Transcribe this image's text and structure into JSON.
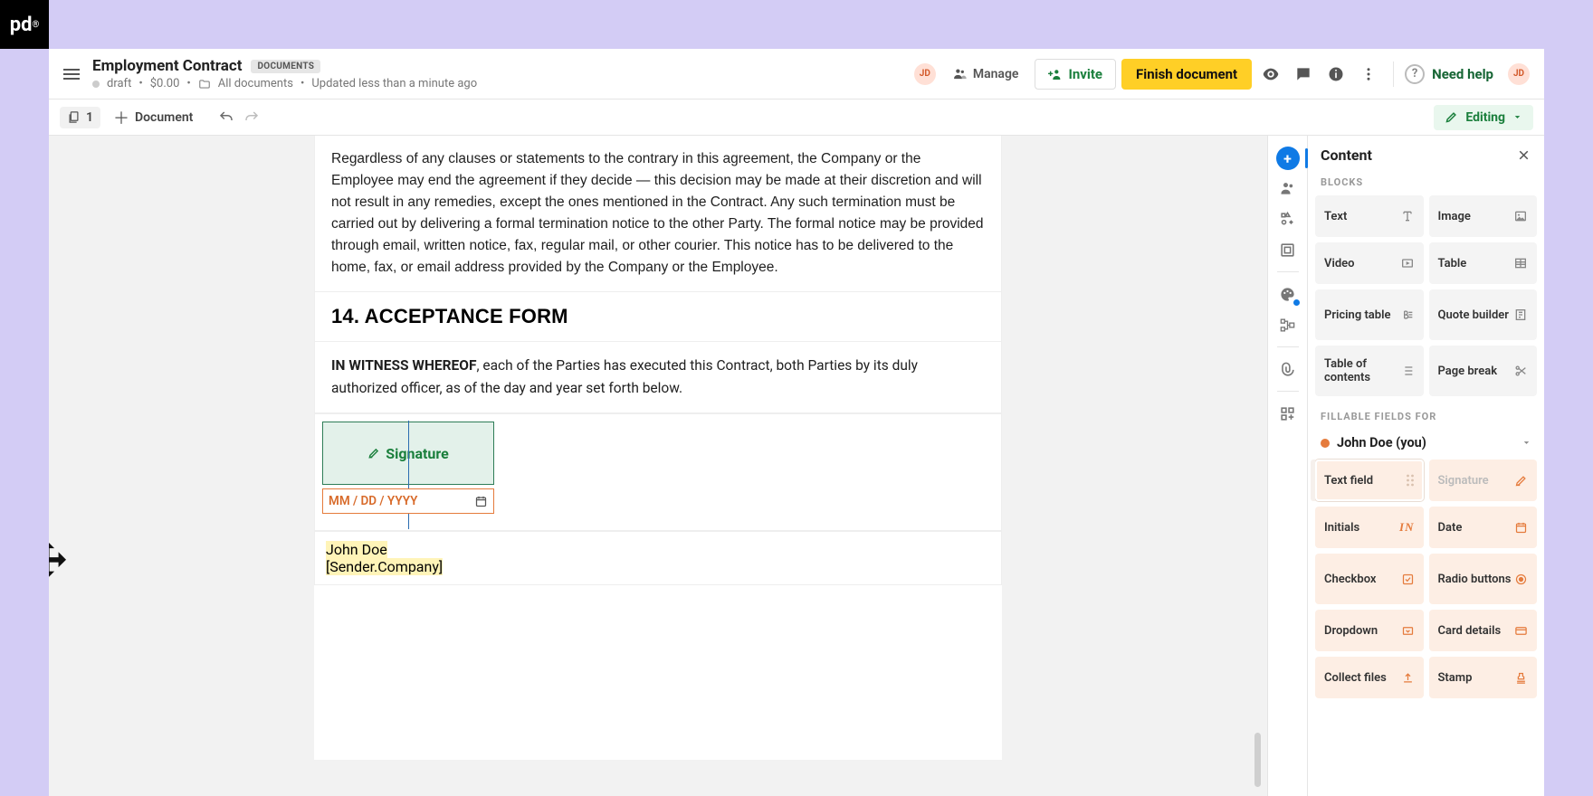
{
  "brand_logo_text": "pd",
  "header": {
    "title": "Employment Contract",
    "badge": "DOCUMENTS",
    "status": "draft",
    "amount": "$0.00",
    "crumb": "All documents",
    "updated": "Updated less than a minute ago",
    "manage": "Manage",
    "invite": "Invite",
    "finish": "Finish document",
    "need_help": "Need help",
    "user_initials": "JD"
  },
  "toolbar": {
    "page_count": "1",
    "add_document": "Document",
    "mode": "Editing"
  },
  "doc": {
    "termination_text": "Regardless of any clauses or statements to the contrary in this agreement, the Company or the Employee may end the agreement if they decide — this decision may be made at their discretion and will not result in any remedies, except the ones mentioned in the Contract. Any such termination must be carried out by delivering a formal termination notice to the other Party. The formal notice may be provided through email, written notice, fax, regular mail, or other courier. This notice has to be delivered to the home, fax, or email address provided by the Company or the Employee.",
    "acceptance_heading": "14. ACCEPTANCE FORM",
    "witness_strong": "IN WITNESS WHEREOF",
    "witness_rest": ", each of the Parties has executed this Contract, both Parties by its duly authorized officer, as of the day and year set forth below.",
    "signature_label": "Signature",
    "date_placeholder": "MM / DD / YYYY",
    "signer_name": "John Doe",
    "company_token": "[Sender.Company]"
  },
  "panel": {
    "title": "Content",
    "blocks_label": "BLOCKS",
    "fillable_label": "FILLABLE FIELDS FOR",
    "assignee": "John Doe (you)",
    "blocks": {
      "text": "Text",
      "image": "Image",
      "video": "Video",
      "table": "Table",
      "pricing": "Pricing table",
      "quote": "Quote builder",
      "toc": "Table of contents",
      "pagebreak": "Page break"
    },
    "fields": {
      "text": "Text field",
      "signature": "Signature",
      "initials": "Initials",
      "date": "Date",
      "checkbox": "Checkbox",
      "radio": "Radio buttons",
      "dropdown": "Dropdown",
      "card": "Card details",
      "collect": "Collect files",
      "stamp": "Stamp"
    }
  }
}
